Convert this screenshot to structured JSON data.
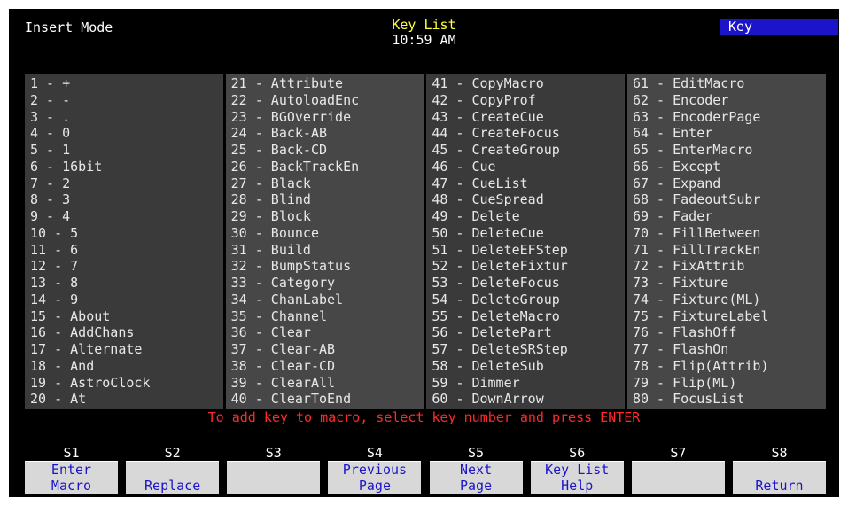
{
  "header": {
    "mode": "Insert Mode",
    "title": "Key List",
    "time": "10:59 AM",
    "field_label": "Key"
  },
  "key_list": [
    [
      "1 - +",
      "2 - -",
      "3 - .",
      "4 - 0",
      "5 - 1",
      "6 - 16bit",
      "7 - 2",
      "8 - 3",
      "9 - 4",
      "10 - 5",
      "11 - 6",
      "12 - 7",
      "13 - 8",
      "14 - 9",
      "15 - About",
      "16 - AddChans",
      "17 - Alternate",
      "18 - And",
      "19 - AstroClock",
      "20 - At"
    ],
    [
      "21 - Attribute",
      "22 - AutoloadEnc",
      "23 - BGOverride",
      "24 - Back-AB",
      "25 - Back-CD",
      "26 - BackTrackEn",
      "27 - Black",
      "28 - Blind",
      "29 - Block",
      "30 - Bounce",
      "31 - Build",
      "32 - BumpStatus",
      "33 - Category",
      "34 - ChanLabel",
      "35 - Channel",
      "36 - Clear",
      "37 - Clear-AB",
      "38 - Clear-CD",
      "39 - ClearAll",
      "40 - ClearToEnd"
    ],
    [
      "41 - CopyMacro",
      "42 - CopyProf",
      "43 - CreateCue",
      "44 - CreateFocus",
      "45 - CreateGroup",
      "46 - Cue",
      "47 - CueList",
      "48 - CueSpread",
      "49 - Delete",
      "50 - DeleteCue",
      "51 - DeleteEFStep",
      "52 - DeleteFixtur",
      "53 - DeleteFocus",
      "54 - DeleteGroup",
      "55 - DeleteMacro",
      "56 - DeletePart",
      "57 - DeleteSRStep",
      "58 - DeleteSub",
      "59 - Dimmer",
      "60 - DownArrow"
    ],
    [
      "61 - EditMacro",
      "62 - Encoder",
      "63 - EncoderPage",
      "64 - Enter",
      "65 - EnterMacro",
      "66 - Except",
      "67 - Expand",
      "68 - FadeoutSubr",
      "69 - Fader",
      "70 - FillBetween",
      "71 - FillTrackEn",
      "72 - FixAttrib",
      "73 - Fixture",
      "74 - Fixture(ML)",
      "75 - FixtureLabel",
      "76 - FlashOff",
      "77 - FlashOn",
      "78 - Flip(Attrib)",
      "79 - Flip(ML)",
      "80 - FocusList"
    ]
  ],
  "hint": "To add key to macro, select key number and press ENTER",
  "softkeys": [
    {
      "slot": "S1",
      "top": "Enter",
      "bottom": "Macro"
    },
    {
      "slot": "S2",
      "top": "",
      "bottom": "Replace"
    },
    {
      "slot": "S3",
      "top": "",
      "bottom": ""
    },
    {
      "slot": "S4",
      "top": "Previous",
      "bottom": "Page"
    },
    {
      "slot": "S5",
      "top": "Next",
      "bottom": "Page"
    },
    {
      "slot": "S6",
      "top": "Key List",
      "bottom": "Help"
    },
    {
      "slot": "S7",
      "top": "",
      "bottom": ""
    },
    {
      "slot": "S8",
      "top": "",
      "bottom": "Return"
    }
  ],
  "colors": {
    "background": "#000000",
    "title": "#ffff3c",
    "hint": "#ff2a2a",
    "field_bg": "#1c14c8",
    "softkey_bg": "#d8d8d8",
    "softkey_text": "#1c14c8"
  }
}
